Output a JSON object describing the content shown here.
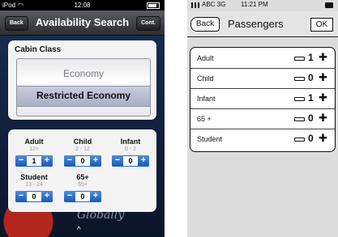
{
  "left_app": {
    "status": {
      "carrier": "iPod",
      "time": "12:08"
    },
    "nav": {
      "back_label": "Back",
      "title": "Availability Search",
      "continue_label": "Cont."
    },
    "cabin": {
      "label": "Cabin Class",
      "options": [
        "Economy",
        "Restricted Economy"
      ],
      "selected": "Restricted Economy"
    },
    "passengers": [
      {
        "name": "Adult",
        "range": "12+",
        "value": "1"
      },
      {
        "name": "Child",
        "range": "2 - 12",
        "value": "0"
      },
      {
        "name": "Infant",
        "range": "0 - 2",
        "value": "0"
      },
      {
        "name": "Student",
        "range": "13 - 24",
        "value": "0"
      },
      {
        "name": "65+",
        "range": "65+",
        "value": "0"
      }
    ],
    "background_text": "Globally",
    "stepper_minus": "−",
    "stepper_plus": "+",
    "home_glyph": "^"
  },
  "right_app": {
    "status": {
      "carrier": "ABC 3G",
      "time": "11:21 PM"
    },
    "nav": {
      "back_label": "Back",
      "title": "Passengers",
      "ok_label": "OK"
    },
    "rows": [
      {
        "label": "Adult",
        "value": "1"
      },
      {
        "label": "Child",
        "value": "0"
      },
      {
        "label": "Infant",
        "value": "1"
      },
      {
        "label": "65 +",
        "value": "0"
      },
      {
        "label": "Student",
        "value": "0"
      }
    ],
    "plus_glyph": "✚"
  }
}
